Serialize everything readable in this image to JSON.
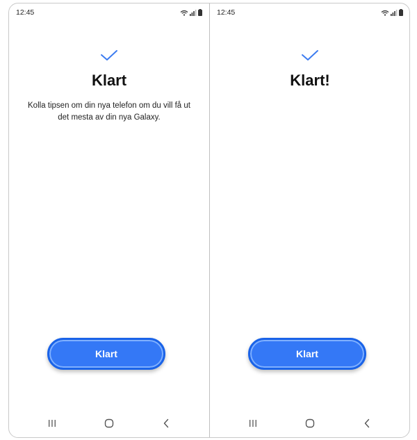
{
  "screens": [
    {
      "status": {
        "time": "12:45"
      },
      "title": "Klart",
      "description": "Kolla tipsen om din nya telefon om du vill få ut det mesta av din nya Galaxy.",
      "button_label": "Klart"
    },
    {
      "status": {
        "time": "12:45"
      },
      "title": "Klart!",
      "button_label": "Klart"
    }
  ],
  "icons": {
    "check": "checkmark-icon",
    "wifi": "wifi-icon",
    "signal": "signal-icon",
    "battery": "battery-icon",
    "recents": "recents-icon",
    "home": "home-icon",
    "back": "back-icon"
  },
  "colors": {
    "accent": "#3478f6",
    "check": "#3d7cf0"
  }
}
